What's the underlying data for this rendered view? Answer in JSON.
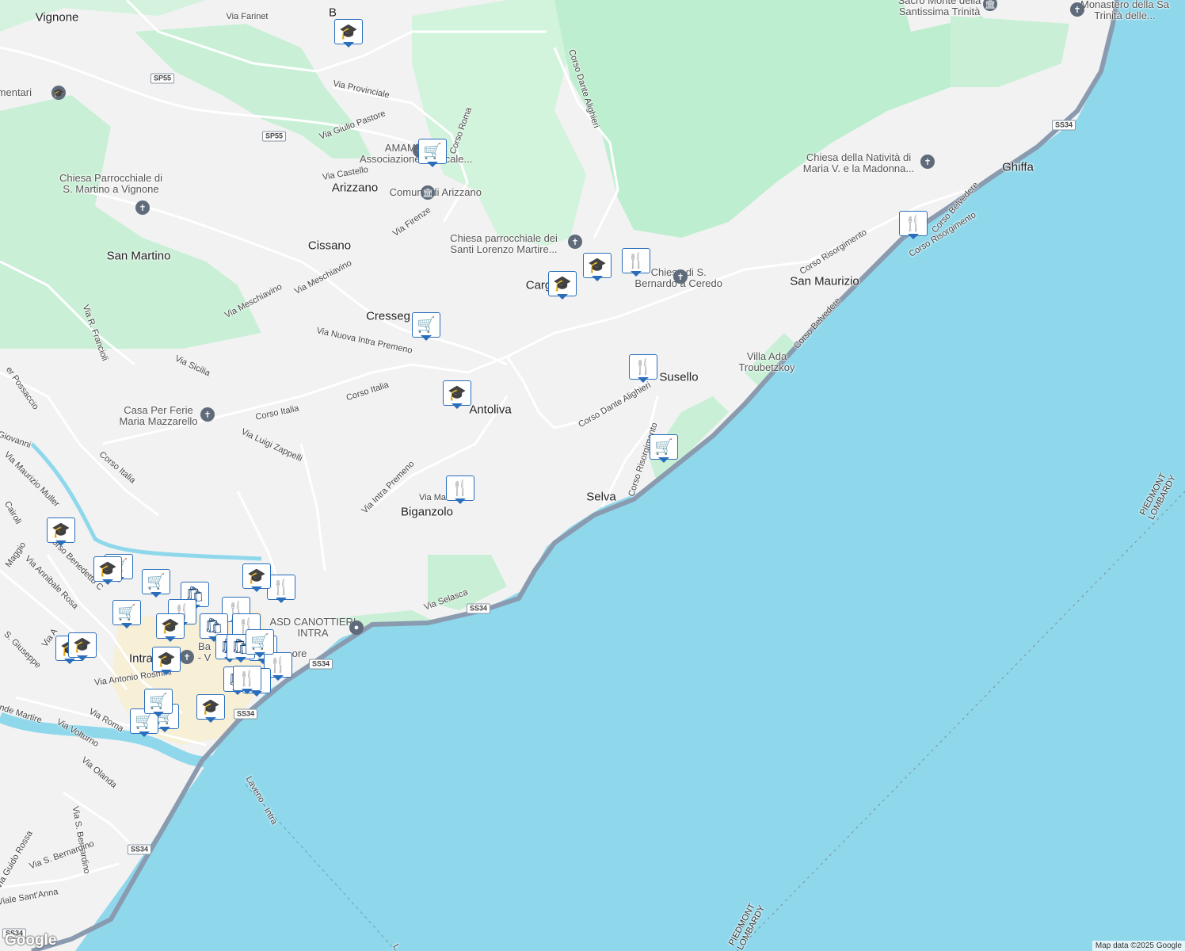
{
  "map": {
    "places": [
      {
        "name": "Vignone"
      },
      {
        "name": "Arizzano"
      },
      {
        "name": "Cissano"
      },
      {
        "name": "San Martino"
      },
      {
        "name": "Cresseg"
      },
      {
        "name": "Carg"
      },
      {
        "name": "Antoliva"
      },
      {
        "name": "Biganzolo"
      },
      {
        "name": "Selva"
      },
      {
        "name": "Susello"
      },
      {
        "name": "San Maurizio"
      },
      {
        "name": "Ghiffa"
      },
      {
        "name": "Intra"
      },
      {
        "name": "B"
      }
    ],
    "pois": [
      {
        "name": "Elementari",
        "icon": "school-icon"
      },
      {
        "name": "AMAMUSICA\nAssociazione Musicale...",
        "icon": "shop-icon"
      },
      {
        "name": "Chiesa Parrocchiale di\nS. Martino a Vignone",
        "icon": "church-icon"
      },
      {
        "name": "Comune di Arizzano",
        "icon": "town-hall-icon"
      },
      {
        "name": "Chiesa parrocchiale dei\nSanti Lorenzo Martire...",
        "icon": "church-icon"
      },
      {
        "name": "Chiesa di S.\nBernardo a Ceredo",
        "icon": "church-icon"
      },
      {
        "name": "Casa Per Ferie\nMaria Mazzarello",
        "icon": "church-icon"
      },
      {
        "name": "Villa Ada\nTroubetzkoy",
        "icon": "none"
      },
      {
        "name": "Chiesa della Natività di\nMaria V. e la Madonna...",
        "icon": "church-icon"
      },
      {
        "name": "Sacro Monte della\nSantissima Trinità",
        "icon": "monument-icon"
      },
      {
        "name": "Monastero della Sa\nTrinità delle...",
        "icon": "church-icon"
      },
      {
        "name": "ASD CANOTTIERI\nINTRA",
        "icon": "pin-icon"
      },
      {
        "name": "Ba\n- V",
        "icon": "church-icon"
      },
      {
        "name": "ore",
        "icon": "none"
      }
    ],
    "roads": [
      "Via Farinet",
      "Via Provinciale",
      "Via Giulio Pastore",
      "Corso Roma",
      "Via Castello",
      "Via Firenze",
      "Via Meschiavino",
      "Via Meschiavino",
      "Via Nuova Intra Premeno",
      "Via Sicilia",
      "Corso Italia",
      "Corso Italia",
      "Via Luigi Zappelli",
      "Corso Italia",
      "Via R. Francioli",
      "Via Intra Premeno",
      "Via Ma",
      "Via Selasca",
      "Corso Dante Alighieri",
      "Corso Dante Alighieri",
      "Corso Risorgimento",
      "Corso Risorgimento",
      "Corso Risorgimento",
      "Corso Belvedere",
      "Corso Belvedere",
      "er Possaccio",
      "Giovanni",
      "Via Maurizio Muller",
      "Cairoli",
      "Maggio",
      "Corso Benedetto C",
      "Via Annibale Rosa",
      "S. Giuseppe",
      "Via A",
      "Via Antonio Rosmini",
      "nde Martire",
      "Via Roma",
      "Via Volturno",
      "Via Olanda",
      "Laveno - Intra",
      "Via Guido Rossa",
      "Via S. Bernardino",
      "Via S. Bernardino",
      "Viale Sant'Anna",
      "L"
    ],
    "shields": [
      "SP55",
      "SP55",
      "SS34",
      "SS34",
      "SS34",
      "SS34",
      "SS34",
      "SS34"
    ],
    "boundary_labels": [
      "PIEDMONT\nLOMBARDY",
      "PIEDMONT\nLOMBARDY"
    ],
    "markers": [
      "school",
      "shopping-cart",
      "school",
      "restaurant",
      "restaurant",
      "school",
      "shopping-cart",
      "restaurant",
      "shopping-cart",
      "school",
      "restaurant",
      "restaurant",
      "restaurant",
      "school",
      "shopping-cart",
      "shopping-cart",
      "shopping-cart",
      "school",
      "shopping-bag",
      "restaurant",
      "shopping-cart",
      "school",
      "shopping-bag",
      "school",
      "restaurant",
      "restaurant",
      "school",
      "shopping-bag",
      "restaurant",
      "shopping-bag",
      "restaurant",
      "shopping-cart",
      "shopping-cart",
      "school",
      "school",
      "shopping-bag",
      "restaurant",
      "shopping-cart",
      "school"
    ],
    "colors": {
      "water": "#8fd8ec",
      "land": "#f2f2f2",
      "park": "#c9f0d6",
      "forest": "#bfeecf",
      "road": "#ffffff",
      "highway": "#8a9bb0",
      "town": "#f7efd6"
    }
  },
  "attribution": "Map data ©2025 Google",
  "logo": "Google"
}
